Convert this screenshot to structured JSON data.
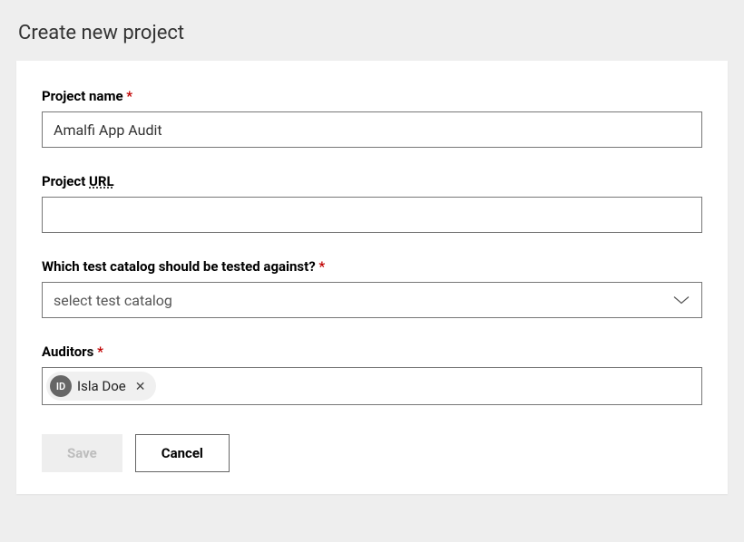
{
  "page": {
    "title": "Create new project"
  },
  "form": {
    "projectName": {
      "label": "Project name",
      "required": "*",
      "value": "Amalfi App Audit"
    },
    "projectUrl": {
      "labelPrefix": "Project ",
      "labelAbbr": "URL",
      "value": ""
    },
    "testCatalog": {
      "label": "Which test catalog should be tested against?",
      "required": "*",
      "placeholder": "select test catalog"
    },
    "auditors": {
      "label": "Auditors",
      "required": "*",
      "chips": [
        {
          "initials": "ID",
          "name": "Isla Doe"
        }
      ],
      "removeSymbol": "✕"
    }
  },
  "buttons": {
    "save": "Save",
    "cancel": "Cancel"
  }
}
